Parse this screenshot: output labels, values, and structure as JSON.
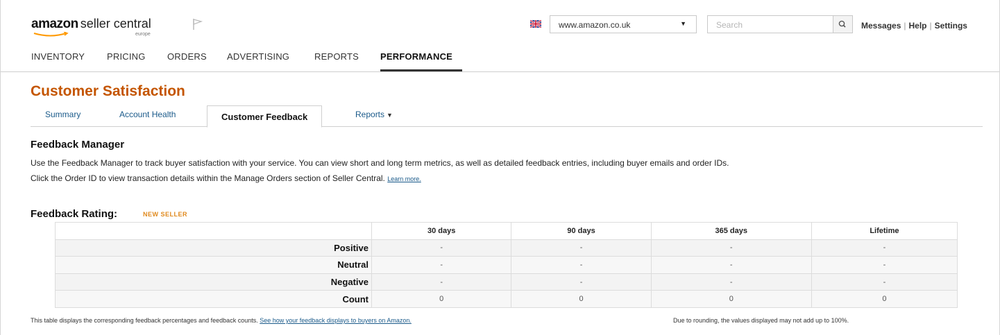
{
  "header": {
    "logo_brand": "amazon",
    "logo_product": "seller central",
    "logo_region": "europe",
    "marketplace": "www.amazon.co.uk",
    "search_placeholder": "Search",
    "links": [
      "Messages",
      "Help",
      "Settings"
    ],
    "flag_icon": "flag-icon",
    "uk_flag_icon": "uk-flag-icon",
    "search_icon": "search-icon"
  },
  "nav": {
    "items": [
      "INVENTORY",
      "PRICING",
      "ORDERS",
      "ADVERTISING",
      "REPORTS",
      "PERFORMANCE"
    ],
    "active": "PERFORMANCE"
  },
  "page": {
    "title": "Customer Satisfaction",
    "tabs": [
      "Summary",
      "Account Health",
      "Customer Feedback",
      "Reports"
    ],
    "active_tab": "Customer Feedback",
    "title_color": "#c45500"
  },
  "feedback_manager": {
    "title": "Feedback Manager",
    "line1": "Use the Feedback Manager to track buyer satisfaction with your service. You can view short and long term metrics, as well as detailed feedback entries, including buyer emails and order IDs.",
    "line2": "Click the Order ID to view transaction details within the Manage Orders section of Seller Central.",
    "learn_more": "Learn more."
  },
  "feedback_rating": {
    "title": "Feedback Rating:",
    "badge": "NEW SELLER",
    "columns": [
      "30 days",
      "90 days",
      "365 days",
      "Lifetime"
    ],
    "rows": [
      {
        "label": "Positive",
        "values": [
          "-",
          "-",
          "-",
          "-"
        ]
      },
      {
        "label": "Neutral",
        "values": [
          "-",
          "-",
          "-",
          "-"
        ]
      },
      {
        "label": "Negative",
        "values": [
          "-",
          "-",
          "-",
          "-"
        ]
      },
      {
        "label": "Count",
        "values": [
          "0",
          "0",
          "0",
          "0"
        ]
      }
    ],
    "footnote_left": "This table displays the corresponding feedback percentages and feedback counts.",
    "footnote_link": "See how your feedback displays to buyers on Amazon.",
    "footnote_right": "Due to rounding, the values displayed may not add up to 100%."
  }
}
